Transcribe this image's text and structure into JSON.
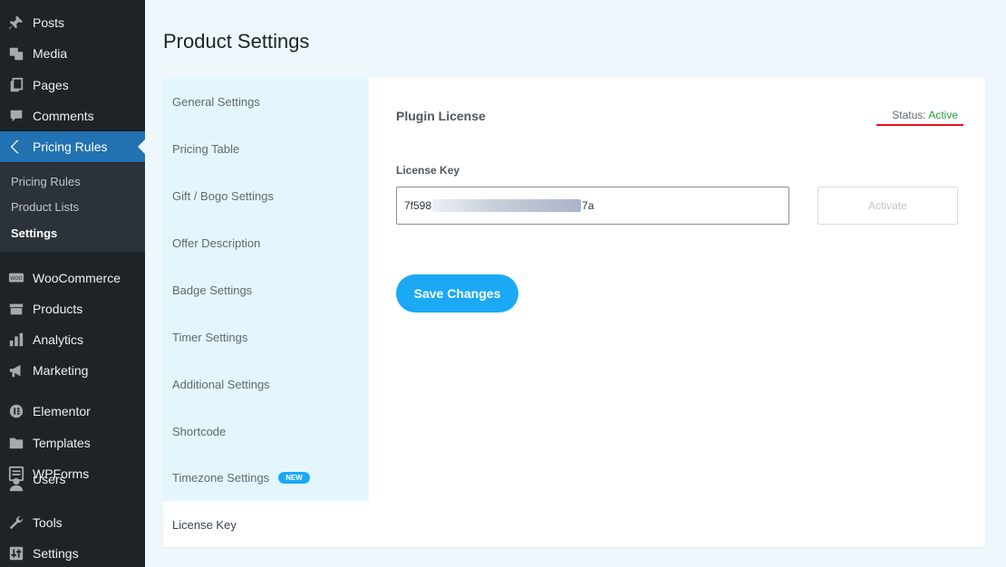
{
  "sidebar": {
    "items": [
      {
        "label": "Posts",
        "icon": "pin-icon"
      },
      {
        "label": "Media",
        "icon": "media-icon"
      },
      {
        "label": "Pages",
        "icon": "pages-icon"
      },
      {
        "label": "Comments",
        "icon": "comments-icon"
      },
      {
        "label": "Pricing Rules",
        "icon": "pricing-rules-icon",
        "active": true
      },
      {
        "label": "WooCommerce",
        "icon": "woocommerce-icon"
      },
      {
        "label": "Products",
        "icon": "products-icon"
      },
      {
        "label": "Analytics",
        "icon": "analytics-icon"
      },
      {
        "label": "Marketing",
        "icon": "megaphone-icon"
      },
      {
        "label": "Elementor",
        "icon": "elementor-icon"
      },
      {
        "label": "Templates",
        "icon": "folder-icon"
      },
      {
        "label": "WPForms",
        "icon": "wpforms-icon"
      },
      {
        "label": "Users",
        "icon": "users-icon"
      },
      {
        "label": "Tools",
        "icon": "wrench-icon"
      },
      {
        "label": "Settings",
        "icon": "sliders-icon"
      }
    ],
    "submenu": [
      {
        "label": "Pricing Rules"
      },
      {
        "label": "Product Lists"
      },
      {
        "label": "Settings",
        "current": true
      }
    ]
  },
  "page": {
    "title": "Product Settings"
  },
  "tabs": [
    {
      "label": "General Settings"
    },
    {
      "label": "Pricing Table"
    },
    {
      "label": "Gift / Bogo Settings"
    },
    {
      "label": "Offer Description"
    },
    {
      "label": "Badge Settings"
    },
    {
      "label": "Timer Settings"
    },
    {
      "label": "Additional Settings"
    },
    {
      "label": "Shortcode"
    },
    {
      "label": "Timezone Settings",
      "badge": "NEW"
    },
    {
      "label": "License Key",
      "active": true
    }
  ],
  "license": {
    "heading": "Plugin License",
    "status_label": "Status:",
    "status_value": "Active",
    "field_label": "License Key",
    "key_prefix": "7f598",
    "key_suffix": "7a",
    "activate_label": "Activate",
    "save_label": "Save Changes"
  },
  "colors": {
    "accent": "#1ba9f5",
    "status_active": "#2a9d3a",
    "sidebar_bg": "#1d2327",
    "sidebar_active": "#2271b1"
  }
}
